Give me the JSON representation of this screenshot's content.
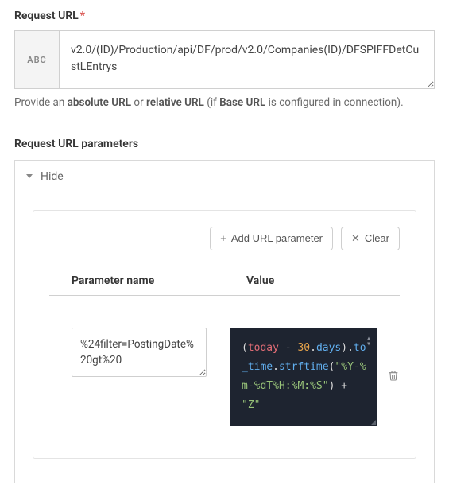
{
  "request_url": {
    "label": "Request URL",
    "prefix_badge": "ABC",
    "value": "v2.0/(ID)/Production/api/DF/prod/v2.0/Companies(ID)/DFSPIFFDetCustLEntrys",
    "helper_parts": {
      "p1": "Provide an ",
      "b1": "absolute URL",
      "p2": " or ",
      "b2": "relative URL",
      "p3": " (if ",
      "b3": "Base URL",
      "p4": " is configured in connection)."
    }
  },
  "url_params": {
    "section_title": "Request URL parameters",
    "toggle_label": "Hide",
    "add_button": "Add URL parameter",
    "clear_button": "Clear",
    "columns": {
      "name": "Parameter name",
      "value": "Value"
    },
    "rows": [
      {
        "name": "%24filter=PostingDate%20gt%20",
        "value_code": {
          "raw": "(today - 30.days).to_time.strftime(\"%Y-%m-%dT%H:%M:%S\") + \"Z\"",
          "tokens": [
            {
              "t": "(",
              "c": "paren"
            },
            {
              "t": "today",
              "c": "kw"
            },
            {
              "t": " - ",
              "c": "op"
            },
            {
              "t": "30",
              "c": "num"
            },
            {
              "t": ".",
              "c": "op"
            },
            {
              "t": "days",
              "c": "method"
            },
            {
              "t": ")",
              "c": "paren"
            },
            {
              "t": ".",
              "c": "op"
            },
            {
              "t": "to_time",
              "c": "method"
            },
            {
              "t": ".",
              "c": "op"
            },
            {
              "t": "strftime",
              "c": "method"
            },
            {
              "t": "(",
              "c": "paren"
            },
            {
              "t": "\"%Y-%m-%dT%H:%M:%S\"",
              "c": "str"
            },
            {
              "t": ")",
              "c": "paren"
            },
            {
              "t": " + ",
              "c": "plus"
            },
            {
              "t": "\"Z\"",
              "c": "str"
            }
          ]
        }
      }
    ]
  }
}
